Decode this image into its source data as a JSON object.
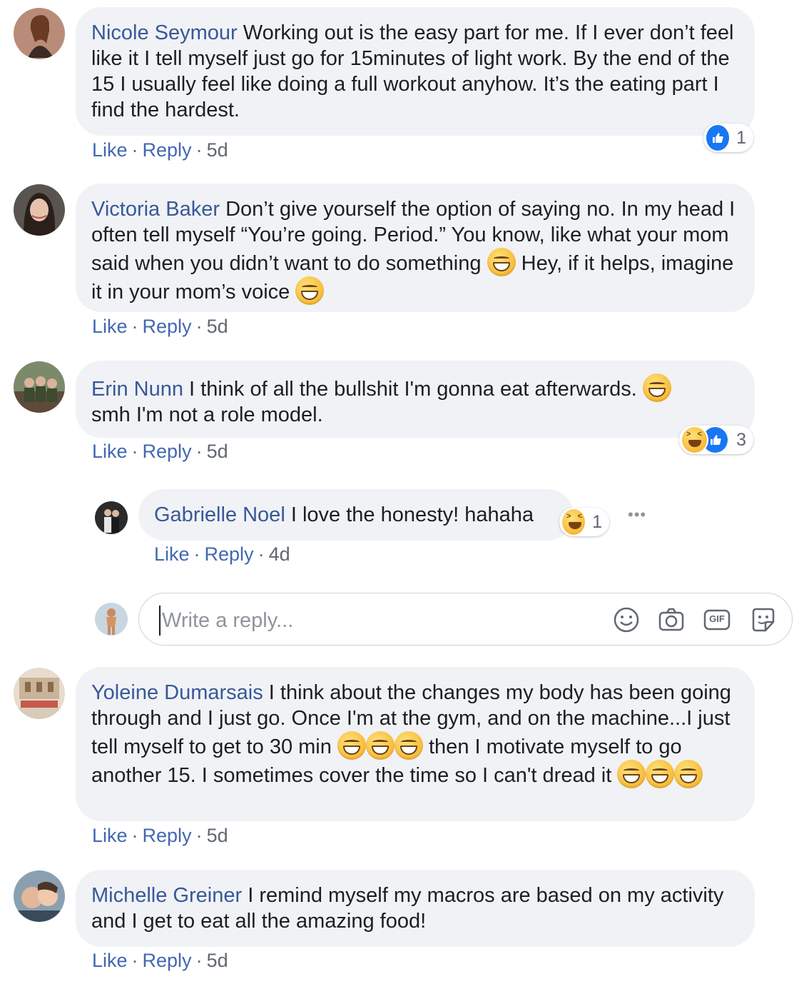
{
  "comments": [
    {
      "author": "Nicole Seymour",
      "text": "Working out is the easy part for me. If I ever don’t feel like it I tell myself just go for 15minutes of light work. By the end of the 15 I usually feel like doing a full workout anyhow. It’s the eating part I find the hardest.",
      "like_label": "Like",
      "reply_label": "Reply",
      "time": "5d",
      "reaction_count": "1"
    },
    {
      "author": "Victoria Baker",
      "text_a": "Don’t give yourself the option of saying no. In my head I often tell myself “You’re going. Period.” You know, like what your mom said when you didn’t want to do something",
      "text_b": "Hey, if it helps, imagine it in your mom’s voice",
      "like_label": "Like",
      "reply_label": "Reply",
      "time": "5d"
    },
    {
      "author": "Erin Nunn",
      "text_a": "I think of all the bullshit I'm gonna eat afterwards.",
      "text_b": "smh I'm not a role model.",
      "like_label": "Like",
      "reply_label": "Reply",
      "time": "5d",
      "reaction_count": "3"
    },
    {
      "author": "Yoleine Dumarsais",
      "text_a": "I think about the changes my body has been going through and I just go. Once I'm at the gym, and on the machine...I just tell myself to get to 30 min",
      "text_b": "then I motivate myself to go another 15. I sometimes cover the time so I can't dread it",
      "like_label": "Like",
      "reply_label": "Reply",
      "time": "5d"
    },
    {
      "author": "Michelle Greiner",
      "text": "I remind myself my macros are based on my activity and I get to eat all the amazing food!",
      "like_label": "Like",
      "reply_label": "Reply",
      "time": "5d"
    }
  ],
  "reply": {
    "author": "Gabrielle Noel",
    "text": "I love the honesty! hahaha",
    "like_label": "Like",
    "reply_label": "Reply",
    "time": "4d",
    "reaction_count": "1",
    "more_label": "•••"
  },
  "reply_box": {
    "placeholder": "Write a reply...",
    "gif_label": "GIF"
  },
  "separator": "·",
  "icons": {
    "like": "like-icon",
    "haha": "haha-icon",
    "emoji": "emoji-icon",
    "camera": "camera-icon",
    "gif": "gif-icon",
    "sticker": "sticker-icon"
  },
  "colors": {
    "name": "#385898",
    "action": "#4267b2",
    "bubble": "#f0f2f5",
    "meta": "#606770",
    "like_blue": "#1877f2"
  }
}
